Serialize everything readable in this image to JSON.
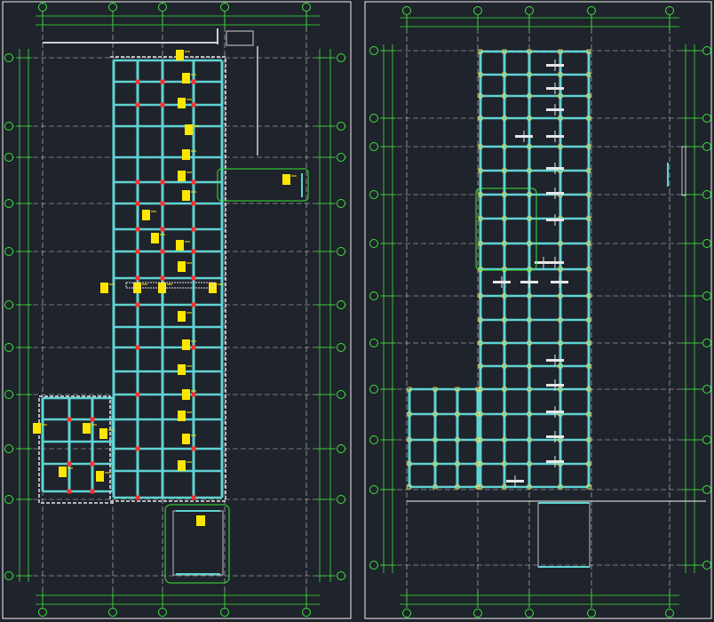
{
  "drawing": {
    "background_color": "#1f232b",
    "colors": {
      "frame": "#f2f2f2",
      "grid_axis": "#cfcfcf",
      "dimension": "#39e639",
      "beam": "#5fd3d3",
      "column": "#ff2e2e",
      "label_block": "#ffe600",
      "outline": "#e6e6e6",
      "node": "#f5e24a"
    }
  },
  "sheets": [
    {
      "name": "left-plan",
      "title": "",
      "note_labels": [
        "",
        ""
      ]
    },
    {
      "name": "right-plan",
      "title": "",
      "note_labels": [
        ""
      ]
    }
  ]
}
